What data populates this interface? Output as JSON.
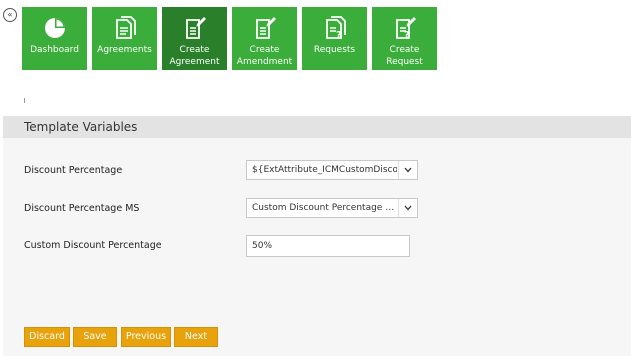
{
  "nav": {
    "collapse_glyph": "«",
    "tiles": [
      {
        "label": "Dashboard",
        "icon": "dashboard-icon",
        "color": "#3aad3a"
      },
      {
        "label": "Agreements",
        "icon": "agreements-icon",
        "color": "#3aad3a"
      },
      {
        "label": "Create Agreement",
        "icon": "create-agreement-icon",
        "color": "#2a7f2a"
      },
      {
        "label": "Create Amendment",
        "icon": "create-amendment-icon",
        "color": "#3aad3a"
      },
      {
        "label": "Requests",
        "icon": "requests-icon",
        "color": "#3aad3a"
      },
      {
        "label": "Create Request",
        "icon": "create-request-icon",
        "color": "#3aad3a"
      }
    ]
  },
  "panel": {
    "title": "Template Variables",
    "fields": [
      {
        "label": "Discount Percentage",
        "value": "${ExtAttribute_ICMCustomDiscountP",
        "type": "select"
      },
      {
        "label": "Discount Percentage MS",
        "value": "Custom Discount Percentage Valu...",
        "type": "select"
      },
      {
        "label": "Custom Discount Percentage",
        "value": "50%",
        "type": "text"
      }
    ]
  },
  "actions": {
    "discard": "Discard",
    "save": "Save",
    "previous": "Previous",
    "next": "Next"
  },
  "colors": {
    "tile_green": "#3aad3a",
    "tile_active": "#2a7f2a",
    "button_orange": "#e8a20c",
    "header_gray": "#e3e3e3"
  }
}
